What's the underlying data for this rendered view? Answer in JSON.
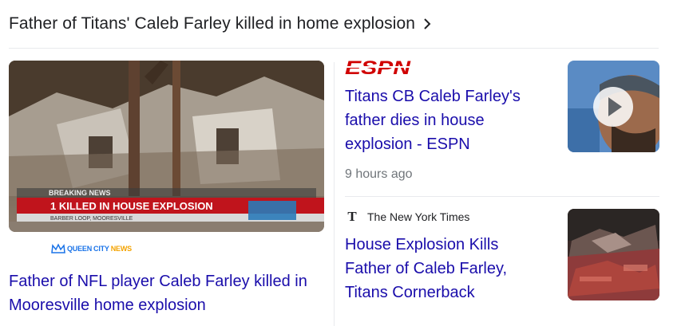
{
  "header": {
    "title": "Father of Titans' Caleb Farley killed in home explosion"
  },
  "main_story": {
    "thumbnail": {
      "breaking_label": "BREAKING NEWS",
      "banner_text": "1 KILLED IN HOUSE EXPLOSION",
      "location_text": "BARBER LOOP, MOORESVILLE"
    },
    "source_logo": {
      "text_queen": "QUEEN",
      "text_city": "CITY",
      "text_news": "NEWS"
    },
    "headline": "Father of NFL player Caleb Farley killed in Mooresville home explosion"
  },
  "stories": [
    {
      "source": "ESPN",
      "headline": "Titans CB Caleb Farley's father dies in house explosion - ESPN",
      "time": "9 hours ago",
      "thumbnail_icon": "play-icon"
    },
    {
      "source": "The New York Times",
      "source_icon": "T",
      "headline": "House Explosion Kills Father of Caleb Farley, Titans Cornerback"
    }
  ],
  "colors": {
    "link": "#1a0dab",
    "text": "#202124",
    "muted": "#70757a",
    "espn_red": "#d00000",
    "divider": "#e8eaed"
  }
}
